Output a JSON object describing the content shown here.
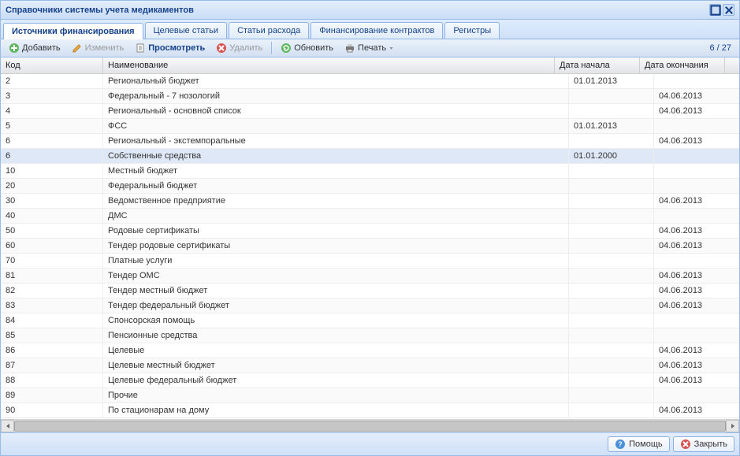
{
  "window": {
    "title": "Справочники системы учета медикаментов"
  },
  "tabs": [
    {
      "label": "Источники финансирования",
      "active": true
    },
    {
      "label": "Целевые статьи",
      "active": false
    },
    {
      "label": "Статьи расхода",
      "active": false
    },
    {
      "label": "Финансирование контрактов",
      "active": false
    },
    {
      "label": "Регистры",
      "active": false
    }
  ],
  "toolbar": {
    "add": "Добавить",
    "edit": "Изменить",
    "view": "Просмотреть",
    "delete": "Удалить",
    "refresh": "Обновить",
    "print": "Печать",
    "count": "6 / 27"
  },
  "columns": {
    "code": "Код",
    "name": "Наименование",
    "date1": "Дата начала",
    "date2": "Дата окончания"
  },
  "rows": [
    {
      "code": "2",
      "name": "Региональный бюджет",
      "d1": "01.01.2013",
      "d2": ""
    },
    {
      "code": "3",
      "name": "Федеральный - 7 нозологий",
      "d1": "",
      "d2": "04.06.2013"
    },
    {
      "code": "4",
      "name": "Региональный - основной список",
      "d1": "",
      "d2": "04.06.2013"
    },
    {
      "code": "5",
      "name": "ФСС",
      "d1": "01.01.2013",
      "d2": ""
    },
    {
      "code": "6",
      "name": "Региональный - экстемпоральные",
      "d1": "",
      "d2": "04.06.2013"
    },
    {
      "code": "6",
      "name": "Собственные средства",
      "d1": "01.01.2000",
      "d2": "",
      "selected": true
    },
    {
      "code": "10",
      "name": "Местный бюджет",
      "d1": "",
      "d2": ""
    },
    {
      "code": "20",
      "name": "Федеральный бюджет",
      "d1": "",
      "d2": ""
    },
    {
      "code": "30",
      "name": "Ведомственное предприятие",
      "d1": "",
      "d2": "04.06.2013"
    },
    {
      "code": "40",
      "name": "ДМС",
      "d1": "",
      "d2": ""
    },
    {
      "code": "50",
      "name": "Родовые сертификаты",
      "d1": "",
      "d2": "04.06.2013"
    },
    {
      "code": "60",
      "name": "Тендер родовые сертификаты",
      "d1": "",
      "d2": "04.06.2013"
    },
    {
      "code": "70",
      "name": "Платные услуги",
      "d1": "",
      "d2": ""
    },
    {
      "code": "81",
      "name": "Тендер ОМС",
      "d1": "",
      "d2": "04.06.2013"
    },
    {
      "code": "82",
      "name": "Тендер местный бюджет",
      "d1": "",
      "d2": "04.06.2013"
    },
    {
      "code": "83",
      "name": "Тендер федеральный бюджет",
      "d1": "",
      "d2": "04.06.2013"
    },
    {
      "code": "84",
      "name": "Спонсорская помощь",
      "d1": "",
      "d2": ""
    },
    {
      "code": "85",
      "name": "Пенсионные средства",
      "d1": "",
      "d2": ""
    },
    {
      "code": "86",
      "name": "Целевые",
      "d1": "",
      "d2": "04.06.2013"
    },
    {
      "code": "87",
      "name": "Целевые местный бюджет",
      "d1": "",
      "d2": "04.06.2013"
    },
    {
      "code": "88",
      "name": "Целевые федеральный бюджет",
      "d1": "",
      "d2": "04.06.2013"
    },
    {
      "code": "89",
      "name": "Прочие",
      "d1": "",
      "d2": ""
    },
    {
      "code": "90",
      "name": "По стационарам на дому",
      "d1": "",
      "d2": "04.06.2013"
    }
  ],
  "footer": {
    "help": "Помощь",
    "close": "Закрыть"
  }
}
